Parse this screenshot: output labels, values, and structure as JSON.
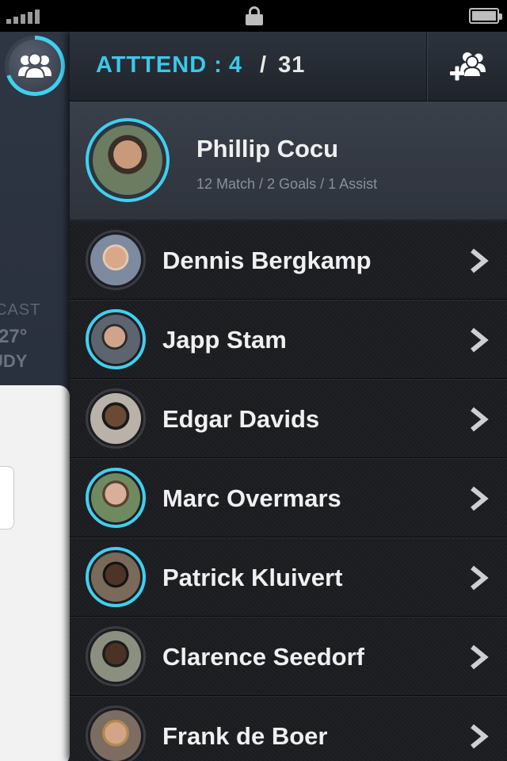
{
  "header": {
    "attend_label": "ATTTEND :",
    "attend_count": "4",
    "separator": "/",
    "total_count": "31"
  },
  "side_panel": {
    "weather_label": "CAST",
    "temperature": "27°",
    "condition": "UDY"
  },
  "featured_player": {
    "name": "Phillip Cocu",
    "stats": "12 Match / 2 Goals / 1 Assist"
  },
  "players": [
    {
      "name": "Dennis Bergkamp",
      "attending": false
    },
    {
      "name": "Japp Stam",
      "attending": true
    },
    {
      "name": "Edgar Davids",
      "attending": false
    },
    {
      "name": "Marc Overmars",
      "attending": true
    },
    {
      "name": "Patrick Kluivert",
      "attending": true
    },
    {
      "name": "Clarence Seedorf",
      "attending": false
    },
    {
      "name": "Frank de Boer",
      "attending": false
    }
  ],
  "icons": {
    "team": "team-icon",
    "add_player": "add-player-icon",
    "row_arrow": "chevron-right-icon",
    "lock": "lock-icon",
    "battery": "battery-icon",
    "signal": "signal-icon"
  },
  "colors": {
    "accent": "#3ac9ea",
    "background": "#1d1e22",
    "header": "#2d333d",
    "text": "#f0f0f0",
    "subtext": "#8a909a"
  }
}
